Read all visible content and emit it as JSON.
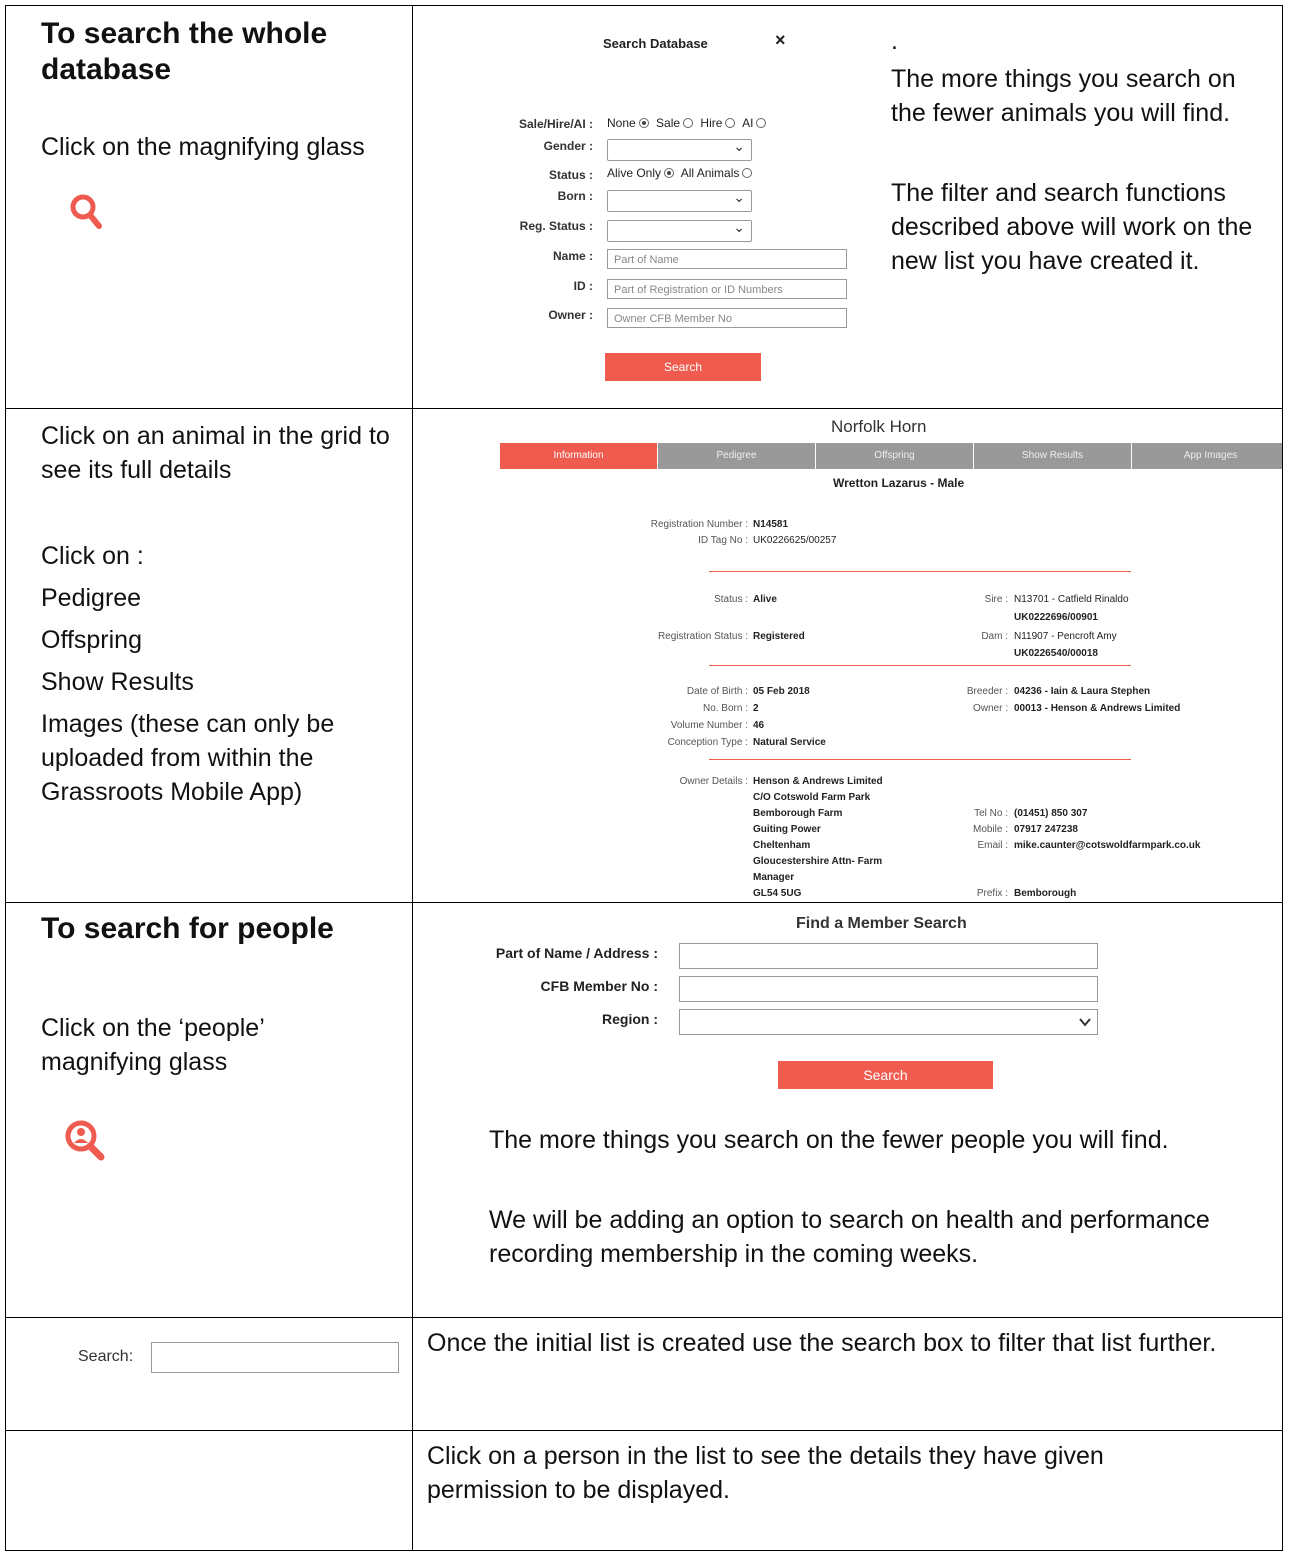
{
  "row1": {
    "heading": "To search the whole database",
    "instruction": "Click on the magnifying glass",
    "icon": "search-icon",
    "search_db": {
      "title": "Search Database",
      "close": "×",
      "sale_label": "Sale/Hire/AI :",
      "sale_options": [
        "None",
        "Sale",
        "Hire",
        "AI"
      ],
      "gender_label": "Gender :",
      "status_label": "Status :",
      "status_options": [
        "Alive Only",
        "All Animals"
      ],
      "born_label": "Born :",
      "reg_label": "Reg. Status :",
      "name_label": "Name :",
      "name_placeholder": "Part of Name",
      "id_label": "ID :",
      "id_placeholder": "Part of Registration or ID Numbers",
      "owner_label": "Owner :",
      "owner_placeholder": "Owner CFB Member No",
      "button": "Search"
    },
    "dot": ".",
    "note1": "The more things you search on the fewer animals you will find.",
    "note2": "The filter and search functions described above will work on the new list you have created it."
  },
  "row2": {
    "line1": "Click on an animal in the grid to see its full details",
    "click_on": "Click on :",
    "items": [
      "Pedigree",
      "Offspring",
      "Show Results",
      "Images (these can only be uploaded from within the Grassroots Mobile App)"
    ],
    "detail": {
      "breed": "Norfolk Horn",
      "tabs": [
        "Information",
        "Pedigree",
        "Offspring",
        "Show Results",
        "App Images"
      ],
      "animal": "Wretton Lazarus - Male",
      "reg_no_label": "Registration Number :",
      "reg_no": "N14581",
      "id_tag_label": "ID Tag No :",
      "id_tag": "UK0226625/00257",
      "status_label": "Status :",
      "status": "Alive",
      "reg_status_label": "Registration Status :",
      "reg_status": "Registered",
      "sire_label": "Sire :",
      "sire": "N13701  -  Catfield Rinaldo",
      "sire_tag": "UK0222696/00901",
      "dam_label": "Dam :",
      "dam": "N11907  -  Pencroft Amy",
      "dam_tag": "UK0226540/00018",
      "dob_label": "Date of Birth :",
      "dob": "05 Feb 2018",
      "born_label": "No. Born :",
      "born": "2",
      "vol_label": "Volume Number :",
      "vol": "46",
      "conc_label": "Conception Type :",
      "conc": "Natural Service",
      "breeder_label": "Breeder :",
      "breeder": "04236  -  Iain & Laura Stephen",
      "owner_label": "Owner :",
      "owner": "00013  -  Henson & Andrews Limited",
      "owner_details_label": "Owner Details :",
      "owner_details": [
        "Henson & Andrews Limited",
        "C/O Cotswold Farm Park",
        "Bemborough Farm",
        "Guiting Power",
        "Cheltenham",
        "Gloucestershire Attn- Farm",
        "Manager",
        "GL54 5UG"
      ],
      "tel_label": "Tel No :",
      "tel": "(01451) 850 307",
      "mobile_label": "Mobile :",
      "mobile": "07917 247238",
      "email_label": "Email :",
      "email": "mike.caunter@cotswoldfarmpark.co.uk",
      "prefix_label": "Prefix :",
      "prefix": "Bemborough"
    }
  },
  "row3": {
    "heading": "To search for people",
    "instruction": "Click on the ‘people’ magnifying glass",
    "icon": "people-search-icon",
    "member": {
      "title": "Find a Member Search",
      "name_label": "Part of Name / Address :",
      "cfb_label": "CFB Member No :",
      "region_label": "Region :",
      "button": "Search"
    },
    "note1": "The more things you search on the fewer people you will find.",
    "note2": "We will be adding an option to search on health and performance recording membership in the coming weeks."
  },
  "row4": {
    "search_label": "Search:",
    "text": "Once the initial list is created use the search box to filter that list further."
  },
  "row5": {
    "text": "Click on a person in the list to see the details they have given permission to be displayed."
  },
  "colors": {
    "accent": "#f05b4f"
  }
}
